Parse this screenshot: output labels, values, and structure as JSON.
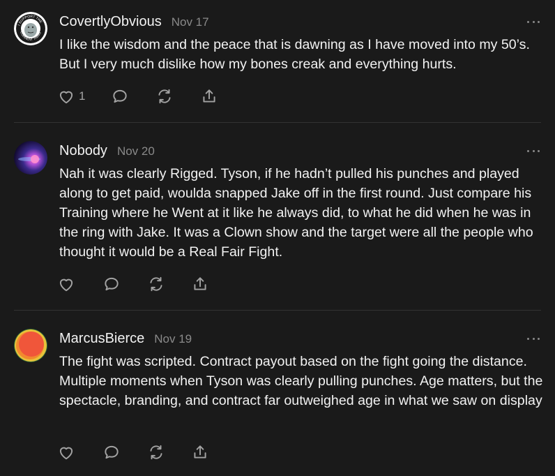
{
  "comments": [
    {
      "author": "CovertlyObvious",
      "date": "Nov 17",
      "avatar_text_top": "I SUPPORT THE",
      "avatar_text_bottom": "CURRENT THING",
      "text": "I like the wisdom and the peace that is dawning as I have moved into my 50’s. But I very much dislike how my bones creak and everything hurts.",
      "like_count": "1"
    },
    {
      "author": "Nobody",
      "date": "Nov 20",
      "text": "Nah it was clearly Rigged. Tyson, if he hadn’t pulled his punches and played along to get paid, woulda snapped Jake off in the first round. Just compare his Training where he Went at it like he always did, to what he did when he was in the ring with Jake. It was a Clown show and the target were all the people who thought it would be a Real Fair Fight.",
      "like_count": ""
    },
    {
      "author": "MarcusBierce",
      "date": "Nov 19",
      "text": "The fight was scripted. Contract payout based on the fight going the distance. Multiple moments when Tyson was clearly pulling punches. Age matters, but the spectacle, branding, and contract far outweighed age in what we saw on display",
      "like_count": ""
    }
  ],
  "icons": {
    "like": "heart-icon",
    "reply": "speech-bubble-icon",
    "restack": "restack-icon",
    "share": "share-icon",
    "more": "ellipsis-icon"
  },
  "colors": {
    "background": "#1a1a1a",
    "text": "#f2f2f2",
    "muted": "#8a8a8a",
    "divider": "#333333"
  }
}
